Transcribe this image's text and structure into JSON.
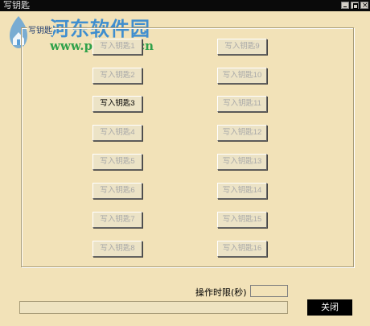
{
  "window": {
    "title": "写钥匙"
  },
  "watermark": {
    "title": "河东软件园",
    "url": "www.pc0359.cn"
  },
  "group": {
    "label": "写钥匙"
  },
  "buttons": {
    "left": [
      "写入钥匙1",
      "写入钥匙2",
      "写入钥匙3",
      "写入钥匙4",
      "写入钥匙5",
      "写入钥匙6",
      "写入钥匙7",
      "写入钥匙8"
    ],
    "right": [
      "写入钥匙9",
      "写入钥匙10",
      "写入钥匙11",
      "写入钥匙12",
      "写入钥匙13",
      "写入钥匙14",
      "写入钥匙15",
      "写入钥匙16"
    ]
  },
  "footer": {
    "time_label": "操作时限(秒)",
    "time_value": "",
    "close_label": "关闭"
  },
  "colors": {
    "background": "#f2e2b8",
    "titlebar": "#0a0a0a",
    "watermark_title": "#3f8ecf",
    "watermark_url": "#2fa14a",
    "disabled_text": "#a8a8a8"
  },
  "icons": [
    "minimize-icon",
    "maximize-icon",
    "close-icon",
    "watermark-logo-icon"
  ]
}
